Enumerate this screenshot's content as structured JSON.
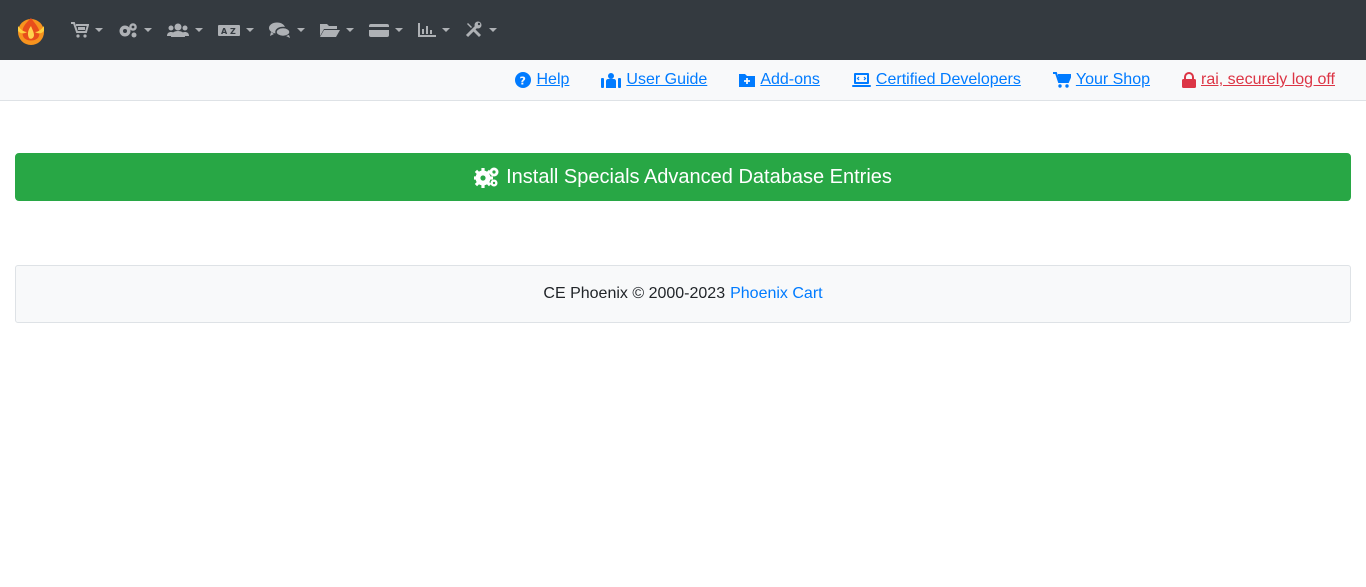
{
  "navbar": {
    "logo_icon": "phoenix-flame-logo",
    "menus": [
      {
        "icon": "cart-icon",
        "name": "catalog"
      },
      {
        "icon": "cogs-icon",
        "name": "modules"
      },
      {
        "icon": "users-icon",
        "name": "customers"
      },
      {
        "icon": "language-icon",
        "name": "localization"
      },
      {
        "icon": "comments-icon",
        "name": "reviews"
      },
      {
        "icon": "folder-open-icon",
        "name": "orders"
      },
      {
        "icon": "credit-card-icon",
        "name": "payment"
      },
      {
        "icon": "chart-icon",
        "name": "reports"
      },
      {
        "icon": "tools-icon",
        "name": "tools"
      }
    ]
  },
  "linkbar": {
    "help": "Help",
    "user_guide": "User Guide",
    "addons": "Add-ons",
    "certified_developers": "Certified Developers",
    "your_shop": "Your Shop",
    "logoff": "rai, securely log off"
  },
  "main": {
    "install_button": "Install Specials Advanced Database Entries"
  },
  "footer": {
    "text": "CE Phoenix © 2000-2023",
    "link": "Phoenix Cart"
  },
  "colors": {
    "navbar_bg": "#343a40",
    "link": "#007bff",
    "danger": "#dc3545",
    "success": "#28a745"
  }
}
